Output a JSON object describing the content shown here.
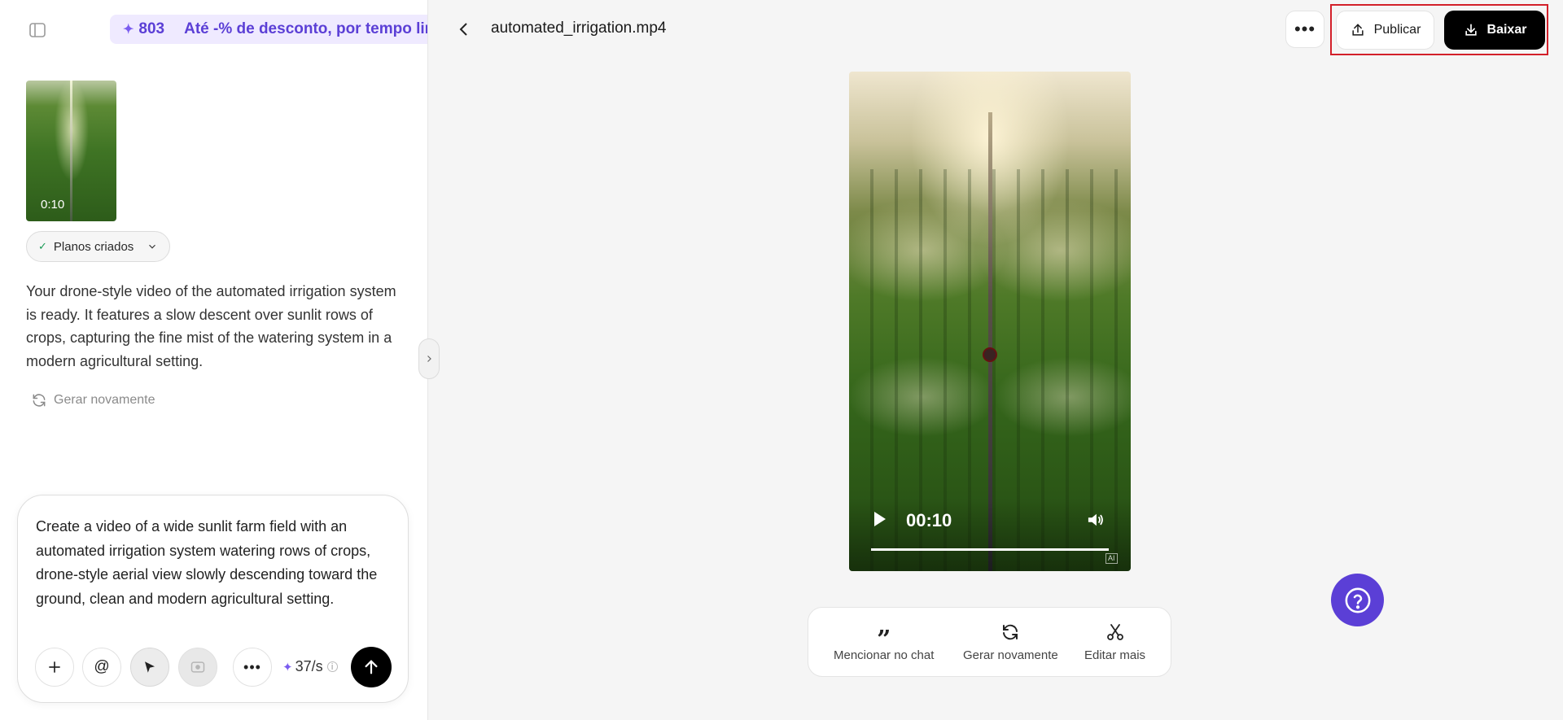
{
  "promo": {
    "count": "803",
    "text": "Até -% de desconto, por tempo limitado"
  },
  "thumbnail": {
    "duration": "0:10"
  },
  "plans_chip": {
    "label": "Planos criados"
  },
  "assistant_message": "Your drone-style video of the automated irrigation system is ready. It features a slow descent over sunlit rows of crops, capturing the fine mist of the watering system in a modern agricultural setting.",
  "regenerate_link": {
    "label": "Gerar novamente"
  },
  "composer": {
    "prompt": "Create a video of a wide sunlit farm field with an automated irrigation system watering rows of crops, drone-style aerial view slowly descending toward the ground, clean and modern agricultural setting.",
    "credits": "37/s"
  },
  "header": {
    "filename": "automated_irrigation.mp4",
    "publish_label": "Publicar",
    "download_label": "Baixar"
  },
  "player": {
    "time": "00:10",
    "progress": 1.0,
    "ai_badge": "AI"
  },
  "actions": {
    "mention": "Mencionar no chat",
    "regenerate": "Gerar novamente",
    "edit": "Editar mais"
  },
  "colors": {
    "accent": "#5b3fd6",
    "highlight": "#d3202a",
    "primary_button": "#000000"
  }
}
